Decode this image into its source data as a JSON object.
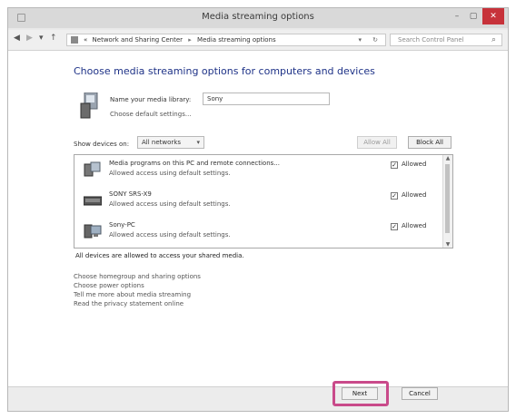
{
  "window": {
    "title": "Media streaming options",
    "controls": {
      "minimize": "–",
      "maximize": "▢",
      "close": "✕"
    }
  },
  "address_bar": {
    "back_icon": "back-arrow-icon",
    "forward_icon": "forward-arrow-icon",
    "up_icon": "up-arrow-icon",
    "breadcrumb": [
      "Network and Sharing Center",
      "Media streaming options"
    ],
    "breadcrumb_prefix": "«",
    "search_placeholder": "Search Control Panel"
  },
  "main": {
    "heading": "Choose media streaming options for computers and devices",
    "library_label": "Name your media library:",
    "library_value": "Sony",
    "default_settings_link": "Choose default settings...",
    "show_devices_label": "Show devices on:",
    "show_devices_value": "All networks",
    "allow_all": "Allow All",
    "block_all": "Block All",
    "devices": [
      {
        "name": "Media programs on this PC and remote connections...",
        "desc": "Allowed access using default settings.",
        "status": "Allowed",
        "checked": true,
        "icon": "media-program-icon"
      },
      {
        "name": "SONY SRS-X9",
        "desc": "Allowed access using default settings.",
        "status": "Allowed",
        "checked": true,
        "icon": "speaker-device-icon"
      },
      {
        "name": "Sony-PC",
        "desc": "Allowed access using default settings.",
        "status": "Allowed",
        "checked": true,
        "icon": "computer-icon"
      }
    ],
    "summary": "All devices are allowed to access your shared media.",
    "links": [
      "Choose homegroup and sharing options",
      "Choose power options",
      "Tell me more about media streaming",
      "Read the privacy statement online"
    ]
  },
  "footer": {
    "next": "Next",
    "cancel": "Cancel"
  },
  "colors": {
    "heading": "#1e3287",
    "close_button": "#c7323a",
    "highlight": "#c94a8a"
  }
}
